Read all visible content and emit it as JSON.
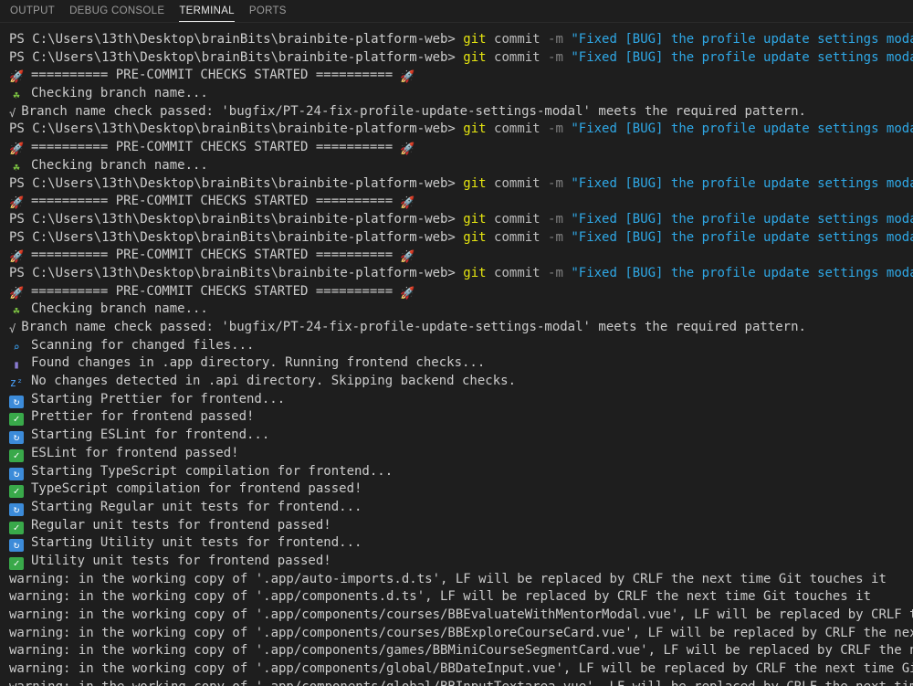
{
  "tabs": [
    {
      "label": "OUTPUT",
      "active": false
    },
    {
      "label": "DEBUG CONSOLE",
      "active": false
    },
    {
      "label": "TERMINAL",
      "active": true
    },
    {
      "label": "PORTS",
      "active": false
    }
  ],
  "colors": {
    "background": "#1e1e1e",
    "text": "#cccccc",
    "git": "#e5e510",
    "string": "#2fa8e6",
    "flag": "#808080"
  },
  "lines": [
    {
      "type": "cmd",
      "prompt": "PS C:\\Users\\13th\\Desktop\\brainBits\\brainbite-platform-web> ",
      "git": "git",
      "sub": "commit",
      "flag": "-m",
      "msg": "\"Fixed [BUG] the profile update settings modal\""
    },
    {
      "type": "cmd",
      "prompt": "PS C:\\Users\\13th\\Desktop\\brainBits\\brainbite-platform-web> ",
      "git": "git",
      "sub": "commit",
      "flag": "-m",
      "msg": "\"Fixed [BUG] the profile update settings modal\""
    },
    {
      "type": "text",
      "icon": "rocket-icon",
      "text": "========== PRE-COMMIT CHECKS STARTED ==========",
      "icon_after": "rocket-icon"
    },
    {
      "type": "text",
      "icon": "leaf-icon",
      "text": "Checking branch name..."
    },
    {
      "type": "text",
      "icon": "tick-icon",
      "text": "Branch name check passed: 'bugfix/PT-24-fix-profile-update-settings-modal' meets the required pattern."
    },
    {
      "type": "cmd",
      "prompt": "PS C:\\Users\\13th\\Desktop\\brainBits\\brainbite-platform-web> ",
      "git": "git",
      "sub": "commit",
      "flag": "-m",
      "msg": "\"Fixed [BUG] the profile update settings modal\""
    },
    {
      "type": "text",
      "icon": "rocket-icon",
      "text": "========== PRE-COMMIT CHECKS STARTED ==========",
      "icon_after": "rocket-icon"
    },
    {
      "type": "text",
      "icon": "leaf-icon",
      "text": "Checking branch name..."
    },
    {
      "type": "cmd",
      "prompt": "PS C:\\Users\\13th\\Desktop\\brainBits\\brainbite-platform-web> ",
      "git": "git",
      "sub": "commit",
      "flag": "-m",
      "msg": "\"Fixed [BUG] the profile update settings modal\""
    },
    {
      "type": "text",
      "icon": "rocket-icon",
      "text": "========== PRE-COMMIT CHECKS STARTED ==========",
      "icon_after": "rocket-icon"
    },
    {
      "type": "cmd",
      "prompt": "PS C:\\Users\\13th\\Desktop\\brainBits\\brainbite-platform-web> ",
      "git": "git",
      "sub": "commit",
      "flag": "-m",
      "msg": "\"Fixed [BUG] the profile update settings modal\""
    },
    {
      "type": "cmd",
      "prompt": "PS C:\\Users\\13th\\Desktop\\brainBits\\brainbite-platform-web> ",
      "git": "git",
      "sub": "commit",
      "flag": "-m",
      "msg": "\"Fixed [BUG] the profile update settings modal\""
    },
    {
      "type": "text",
      "icon": "rocket-icon",
      "text": "========== PRE-COMMIT CHECKS STARTED ==========",
      "icon_after": "rocket-icon"
    },
    {
      "type": "cmd",
      "prompt": "PS C:\\Users\\13th\\Desktop\\brainBits\\brainbite-platform-web> ",
      "git": "git",
      "sub": "commit",
      "flag": "-m",
      "msg": "\"Fixed [BUG] the profile update settings modal\""
    },
    {
      "type": "text",
      "icon": "rocket-icon",
      "text": "========== PRE-COMMIT CHECKS STARTED ==========",
      "icon_after": "rocket-icon"
    },
    {
      "type": "text",
      "icon": "leaf-icon",
      "text": "Checking branch name..."
    },
    {
      "type": "text",
      "icon": "tick-icon",
      "text": "Branch name check passed: 'bugfix/PT-24-fix-profile-update-settings-modal' meets the required pattern."
    },
    {
      "type": "text",
      "icon": "magnifier-icon",
      "text": "Scanning for changed files..."
    },
    {
      "type": "text",
      "icon": "phone-icon",
      "text": "Found changes in .app directory. Running frontend checks..."
    },
    {
      "type": "text",
      "icon": "zzz-icon",
      "text": "No changes detected in .api directory. Skipping backend checks."
    },
    {
      "type": "text",
      "icon": "refresh-icon",
      "text": "Starting Prettier for frontend..."
    },
    {
      "type": "text",
      "icon": "check-icon",
      "text": "Prettier for frontend passed!"
    },
    {
      "type": "text",
      "icon": "refresh-icon",
      "text": "Starting ESLint for frontend..."
    },
    {
      "type": "text",
      "icon": "check-icon",
      "text": "ESLint for frontend passed!"
    },
    {
      "type": "text",
      "icon": "refresh-icon",
      "text": "Starting TypeScript compilation for frontend..."
    },
    {
      "type": "text",
      "icon": "check-icon",
      "text": "TypeScript compilation for frontend passed!"
    },
    {
      "type": "text",
      "icon": "refresh-icon",
      "text": "Starting Regular unit tests for frontend..."
    },
    {
      "type": "text",
      "icon": "check-icon",
      "text": "Regular unit tests for frontend passed!"
    },
    {
      "type": "text",
      "icon": "refresh-icon",
      "text": "Starting Utility unit tests for frontend..."
    },
    {
      "type": "text",
      "icon": "check-icon",
      "text": "Utility unit tests for frontend passed!"
    },
    {
      "type": "text",
      "text": "warning: in the working copy of '.app/auto-imports.d.ts', LF will be replaced by CRLF the next time Git touches it"
    },
    {
      "type": "text",
      "text": "warning: in the working copy of '.app/components.d.ts', LF will be replaced by CRLF the next time Git touches it"
    },
    {
      "type": "text",
      "text": "warning: in the working copy of '.app/components/courses/BBEvaluateWithMentorModal.vue', LF will be replaced by CRLF the next time Git touches it"
    },
    {
      "type": "text",
      "text": "warning: in the working copy of '.app/components/courses/BBExploreCourseCard.vue', LF will be replaced by CRLF the next time Git touches it"
    },
    {
      "type": "text",
      "text": "warning: in the working copy of '.app/components/games/BBMiniCourseSegmentCard.vue', LF will be replaced by CRLF the next time Git touches it"
    },
    {
      "type": "text",
      "text": "warning: in the working copy of '.app/components/global/BBDateInput.vue', LF will be replaced by CRLF the next time Git touches it"
    },
    {
      "type": "text",
      "text": "warning: in the working copy of '.app/components/global/BBInputTextarea.vue', LF will be replaced by CRLF the next time Git touches it"
    }
  ]
}
